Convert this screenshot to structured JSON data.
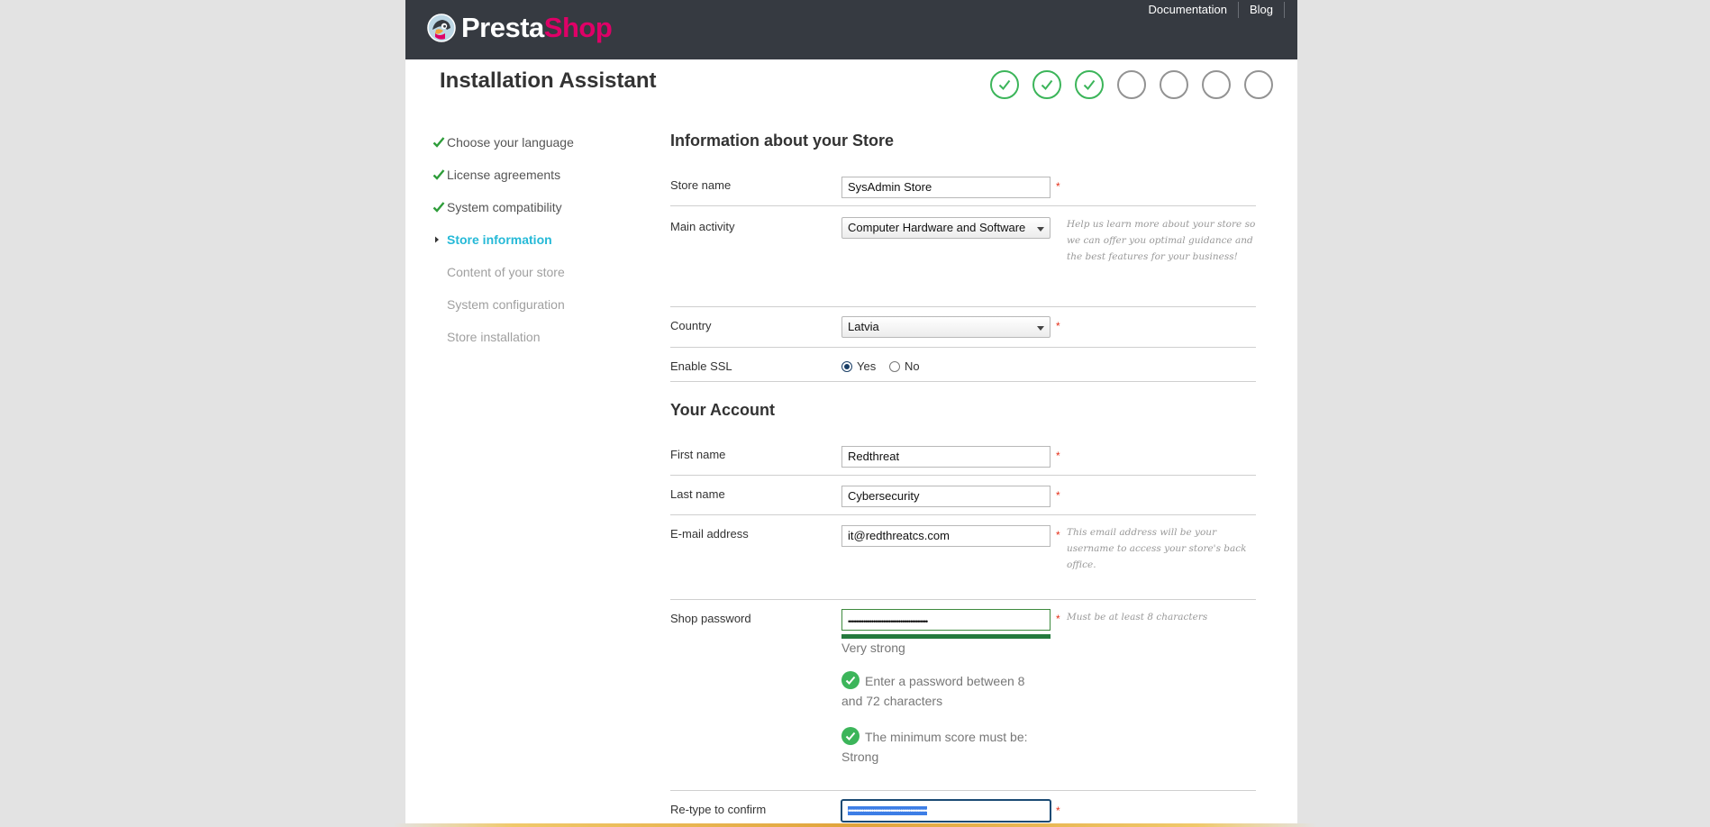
{
  "header": {
    "logo_word1": "Presta",
    "logo_word2": "Shop",
    "links": [
      "Documentation",
      "Blog"
    ]
  },
  "page_title": "Installation Assistant",
  "progress": {
    "total_steps": 7,
    "completed_steps": 3
  },
  "sidebar": {
    "items": [
      {
        "label": "Choose your language",
        "state": "done"
      },
      {
        "label": "License agreements",
        "state": "done"
      },
      {
        "label": "System compatibility",
        "state": "done"
      },
      {
        "label": "Store information",
        "state": "current"
      },
      {
        "label": "Content of your store",
        "state": "todo"
      },
      {
        "label": "System configuration",
        "state": "todo"
      },
      {
        "label": "Store installation",
        "state": "todo"
      }
    ]
  },
  "store_section": {
    "title": "Information about your Store",
    "store_name": {
      "label": "Store name",
      "value": "SysAdmin Store"
    },
    "main_activity": {
      "label": "Main activity",
      "value": "Computer Hardware and Software",
      "hint": "Help us learn more about your store so we can offer you optimal guidance and the best features for your business!"
    },
    "country": {
      "label": "Country",
      "value": "Latvia"
    },
    "ssl": {
      "label": "Enable SSL",
      "yes": "Yes",
      "no": "No",
      "selected": "Yes"
    },
    "required_mark": "*"
  },
  "account_section": {
    "title": "Your Account",
    "first_name": {
      "label": "First name",
      "value": "Redthreat"
    },
    "last_name": {
      "label": "Last name",
      "value": "Cybersecurity"
    },
    "email": {
      "label": "E-mail address",
      "value": "it@redthreatcs.com",
      "hint": "This email address will be your username to access your store's back office."
    },
    "password": {
      "label": "Shop password",
      "masked": "•••••••••••••••••••••••••••••••••••••••••",
      "hint": "Must be at least 8 characters",
      "strength": "Very strong",
      "checks": [
        "Enter a password between 8 and 72 characters",
        "The minimum score must be: Strong"
      ]
    },
    "confirm": {
      "label": "Re-type to confirm",
      "masked": "•••••••••••••••••••••••••••••••••••••••••"
    }
  }
}
